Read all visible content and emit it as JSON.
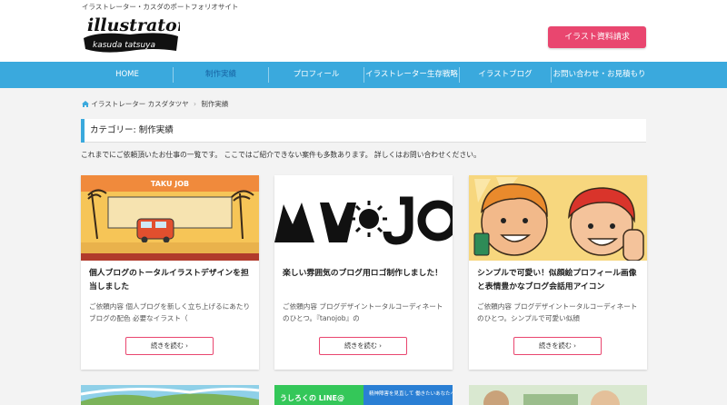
{
  "site": {
    "tagline": "イラストレーター・カスダのポートフォリオサイト",
    "logo_text": "illustrator",
    "logo_sub": "kasuda tatsuya",
    "cta_label": "イラスト資料請求"
  },
  "nav": {
    "items": [
      {
        "label": "HOME"
      },
      {
        "label": "制作実績"
      },
      {
        "label": "プロフィール"
      },
      {
        "label": "イラストレーター生存戦略"
      },
      {
        "label": "イラストブログ"
      },
      {
        "label": "お問い合わせ・お見積もり"
      }
    ]
  },
  "breadcrumb": {
    "home": "イラストレーター カスダタツヤ",
    "current": "制作実績"
  },
  "category": {
    "title": "カテゴリー: 制作実績"
  },
  "intro": "これまでにご依頼頂いたお仕事の一覧です。 ここではご紹介できない案件も多数あります。 詳しくはお問い合わせください。",
  "cards": [
    {
      "title": "個人ブログのトータルイラストデザインを担当しました",
      "excerpt": "ご依頼内容 個人ブログを新しく立ち上げるにあたり ブログの配色 必要なイラスト（",
      "more": "続きを読む ›",
      "thumb_text": "TAKU JOB"
    },
    {
      "title": "楽しい雰囲気のブログ用ロゴ制作しました！",
      "excerpt": "ご依頼内容 ブログデザイントータルコーディネートのひとつ。『tanojob』の",
      "more": "続きを読む ›"
    },
    {
      "title": "シンプルで可愛い！似顔絵プロフィール画像と表情豊かなブログ会話用アイコン",
      "excerpt": "ご依頼内容 ブログデザイントータルコーディネートのひとつ。シンプルで可愛い似顔",
      "more": "続きを読む ›"
    }
  ],
  "cards_row2": [
    {},
    {
      "banner_left": "うしろくの LINE@",
      "banner_right": "精神障害を見直して 働きたいあなたへ…"
    },
    {}
  ],
  "colors": {
    "accent_blue": "#3aa9dd",
    "accent_pink": "#e9466f"
  }
}
